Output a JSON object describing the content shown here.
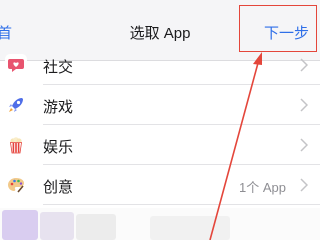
{
  "nav": {
    "back_fragment": "首",
    "title": "选取 App",
    "next_label": "下一步"
  },
  "list": {
    "items": [
      {
        "label": "社交",
        "icon": "social-icon",
        "detail": ""
      },
      {
        "label": "游戏",
        "icon": "game-rocket-icon",
        "detail": ""
      },
      {
        "label": "娱乐",
        "icon": "entertainment-popcorn-icon",
        "detail": ""
      },
      {
        "label": "创意",
        "icon": "creativity-palette-icon",
        "detail": "1个 App"
      }
    ]
  },
  "colors": {
    "accent": "#2f6fe8",
    "annotation": "#e4463b",
    "social_icon": "#e8546f",
    "game_icon": "#4f6ee8",
    "popcorn_icon": "#e5433b"
  }
}
